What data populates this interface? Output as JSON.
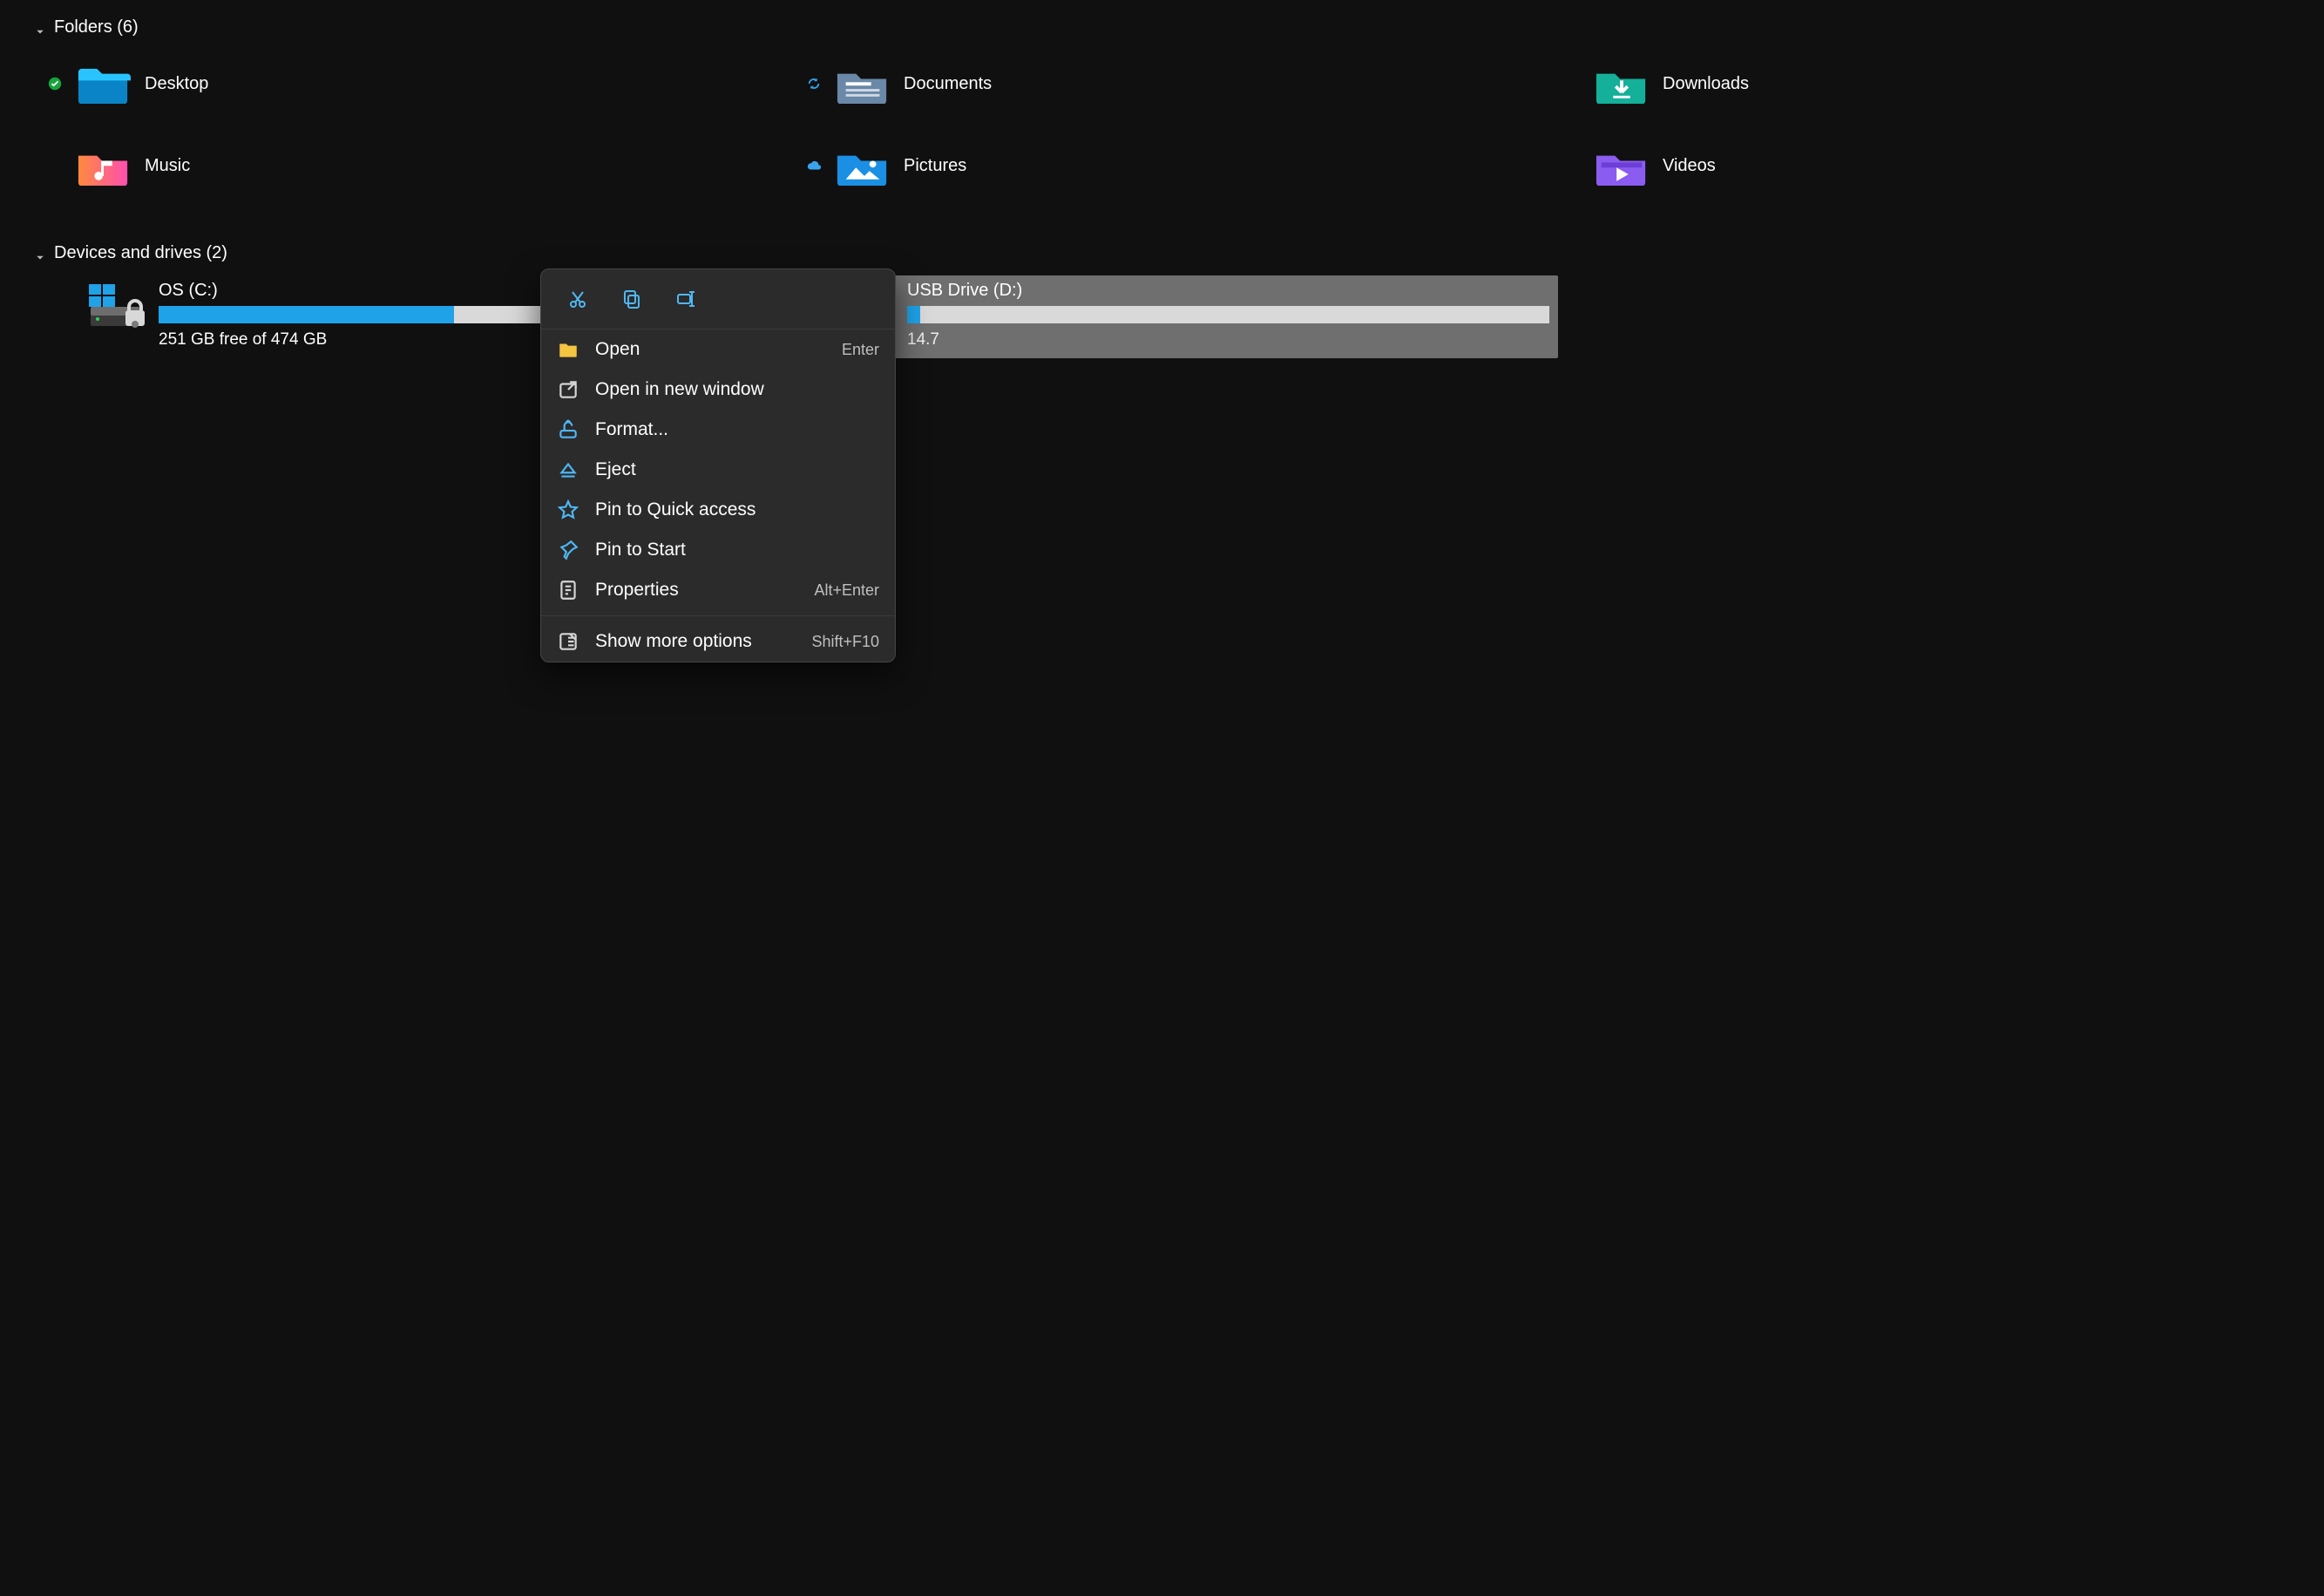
{
  "folders_group": {
    "label": "Folders (6)",
    "items": [
      {
        "name": "Desktop",
        "status": "synced"
      },
      {
        "name": "Documents",
        "status": "sync"
      },
      {
        "name": "Downloads",
        "status": "none"
      },
      {
        "name": "Music",
        "status": "none"
      },
      {
        "name": "Pictures",
        "status": "cloud"
      },
      {
        "name": "Videos",
        "status": "none"
      }
    ]
  },
  "drives_group": {
    "label": "Devices and drives (2)",
    "items": [
      {
        "name": "OS (C:)",
        "free_text": "251 GB free of 474 GB",
        "used_pct": 46,
        "selected": false,
        "icon": "bitlocker"
      },
      {
        "name": "USB Drive (D:)",
        "free_text": "14.7",
        "used_pct": 2,
        "selected": true,
        "icon": "usb"
      }
    ]
  },
  "context_menu": {
    "top_actions": [
      "cut",
      "copy",
      "rename"
    ],
    "items": [
      {
        "icon": "open-folder",
        "label": "Open",
        "shortcut": "Enter"
      },
      {
        "icon": "new-window",
        "label": "Open in new window",
        "shortcut": ""
      },
      {
        "icon": "format",
        "label": "Format...",
        "shortcut": ""
      },
      {
        "icon": "eject",
        "label": "Eject",
        "shortcut": ""
      },
      {
        "icon": "star",
        "label": "Pin to Quick access",
        "shortcut": ""
      },
      {
        "icon": "pin",
        "label": "Pin to Start",
        "shortcut": ""
      },
      {
        "icon": "properties",
        "label": "Properties",
        "shortcut": "Alt+Enter"
      },
      {
        "sep": true
      },
      {
        "icon": "more",
        "label": "Show more options",
        "shortcut": "Shift+F10"
      }
    ]
  }
}
